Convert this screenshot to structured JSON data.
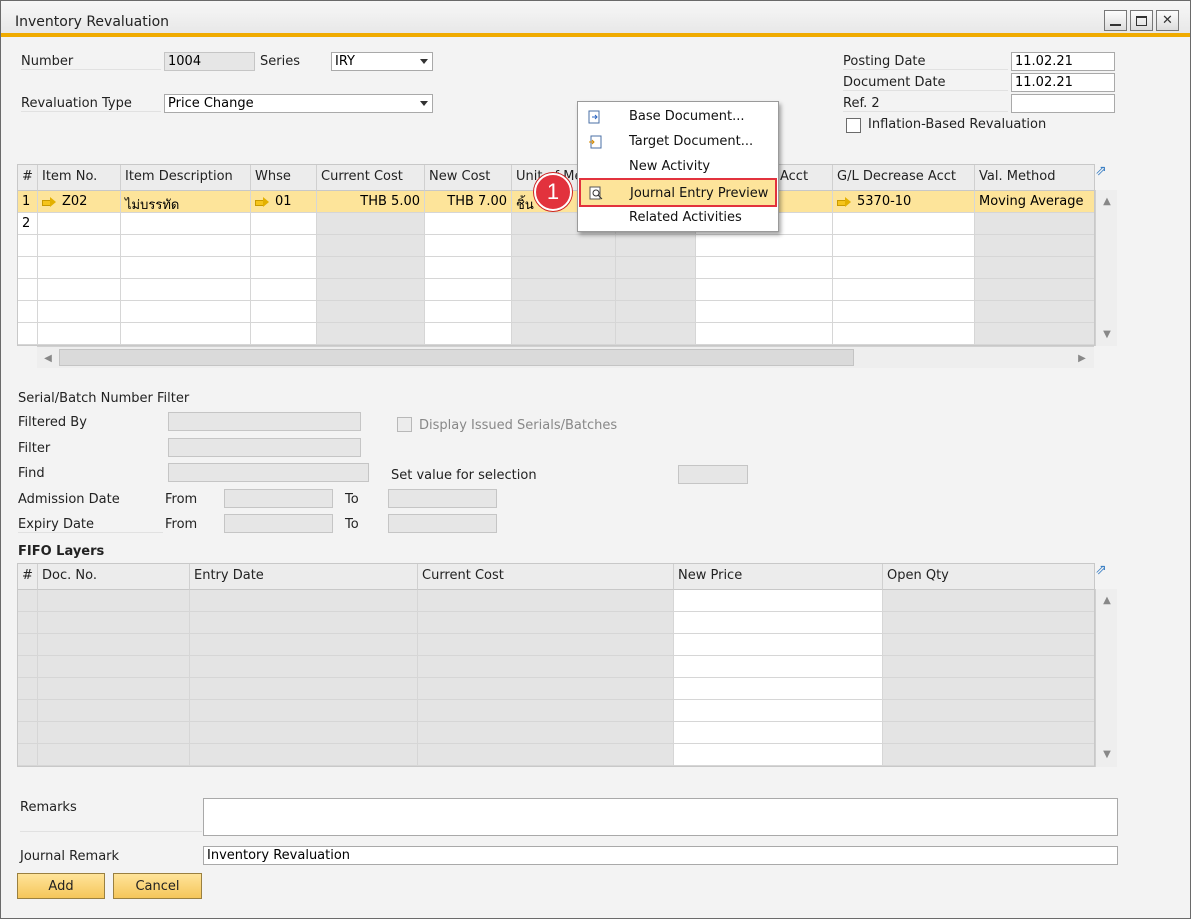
{
  "window": {
    "title": "Inventory Revaluation"
  },
  "header": {
    "number_label": "Number",
    "number_value": "1004",
    "series_label": "Series",
    "series_value": "IRY",
    "revaluation_type_label": "Revaluation Type",
    "revaluation_type_value": "Price Change",
    "posting_date_label": "Posting Date",
    "posting_date_value": "11.02.21",
    "document_date_label": "Document Date",
    "document_date_value": "11.02.21",
    "ref2_label": "Ref. 2",
    "ref2_value": "",
    "inflation_label": "Inflation-Based Revaluation"
  },
  "items_table": {
    "columns": [
      "#",
      "Item No.",
      "Item Description",
      "Whse",
      "Current Cost",
      "New Cost",
      "Unit of Me",
      "Acct",
      "G/L Decrease Acct",
      "Val. Method"
    ],
    "rows": [
      {
        "num": "1",
        "item_no": "Z02",
        "description": "ไม่บรรทัด",
        "whse": "01",
        "current_cost": "THB 5.00",
        "new_cost": "THB 7.00",
        "uom": "ชิ้น",
        "gl_decrease": "5370-10",
        "val_method": "Moving Average"
      },
      {
        "num": "2"
      }
    ]
  },
  "context_menu": {
    "items": [
      {
        "label": "Base Document...",
        "icon": "base-document-icon"
      },
      {
        "label": "Target Document...",
        "icon": "target-document-icon"
      },
      {
        "label": "New Activity"
      },
      {
        "label": "Journal Entry Preview",
        "icon": "journal-preview-icon"
      },
      {
        "label": "Related Activities"
      }
    ],
    "badge": "1"
  },
  "filter": {
    "section_title": "Serial/Batch Number Filter",
    "filtered_by_label": "Filtered By",
    "filter_label": "Filter",
    "find_label": "Find",
    "display_issued_label": "Display Issued Serials/Batches",
    "set_value_label": "Set value for selection",
    "admission_date_label": "Admission Date",
    "expiry_date_label": "Expiry Date",
    "from_label": "From",
    "to_label": "To"
  },
  "fifo": {
    "section_title": "FIFO Layers",
    "columns": [
      "#",
      "Doc. No.",
      "Entry Date",
      "Current Cost",
      "New Price",
      "Open Qty"
    ]
  },
  "footer": {
    "remarks_label": "Remarks",
    "journal_remark_label": "Journal Remark",
    "journal_remark_value": "Inventory Revaluation",
    "add_label": "Add",
    "cancel_label": "Cancel"
  },
  "colors": {
    "accent": "#f0ab00",
    "selection": "#fde49a",
    "highlight_border": "#e2323d"
  }
}
